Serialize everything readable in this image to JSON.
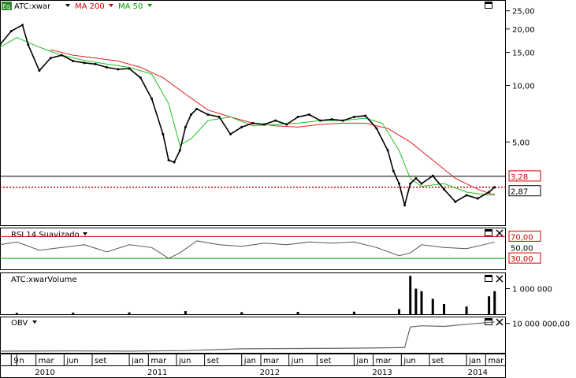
{
  "colors": {
    "ma200": "#e02020",
    "ma50": "#20c020",
    "price": "#000000",
    "rsi": "#555555",
    "level_red": "#d00000",
    "level_green": "#00a000",
    "volume": "#000000",
    "obv": "#666666",
    "grid": "#000000"
  },
  "icons": {
    "eq_badge": "eq-badge-icon",
    "maximize": "maximize-icon",
    "close": "close-icon",
    "dropdown": "dropdown-arrow-icon"
  },
  "header": {
    "badge": "Eq",
    "symbol": "ATC:xwar",
    "ma200_label": "MA 200",
    "ma50_label": "MA 50"
  },
  "price_panel": {
    "axis_ticks": [
      {
        "value": 25,
        "label": "25,00"
      },
      {
        "value": 20,
        "label": "20,00"
      },
      {
        "value": 15,
        "label": "15,00"
      },
      {
        "value": 10,
        "label": "10,00"
      },
      {
        "value": 5,
        "label": "5,00"
      }
    ],
    "level_high": {
      "value": 3.28,
      "label": "3,28"
    },
    "last_price": {
      "value": 2.87,
      "label": "2,87"
    },
    "scale": "log",
    "ylim": [
      1.8,
      28
    ]
  },
  "rsi_panel": {
    "title": "RSI 14 Suavizado",
    "ticks": [
      {
        "value": 70,
        "label": "70,00"
      },
      {
        "value": 50,
        "label": "50,00"
      },
      {
        "value": 30,
        "label": "30,00"
      }
    ],
    "ylim": [
      10,
      85
    ]
  },
  "volume_panel": {
    "title": "ATC:xwarVolume",
    "tick": {
      "value": 1000000,
      "label": "1 000 000"
    },
    "ylim": [
      0,
      1600000
    ]
  },
  "obv_panel": {
    "title": "OBV",
    "tick": {
      "value": 10000000,
      "label": "10 000 000,00"
    },
    "ylim": [
      0,
      12000000
    ]
  },
  "time_axis": {
    "month_labels": [
      {
        "date": "2009.95",
        "label": "9"
      },
      {
        "date": "2010.0",
        "label": "n"
      },
      {
        "date": "2010.17",
        "label": "mar"
      },
      {
        "date": "2010.42",
        "label": "jun"
      },
      {
        "date": "2010.67",
        "label": "set"
      },
      {
        "date": "2011.0",
        "label": "jan"
      },
      {
        "date": "2011.17",
        "label": "mar"
      },
      {
        "date": "2011.42",
        "label": "jun"
      },
      {
        "date": "2011.67",
        "label": "set"
      },
      {
        "date": "2012.0",
        "label": "jan"
      },
      {
        "date": "2012.17",
        "label": "mar"
      },
      {
        "date": "2012.42",
        "label": "jun"
      },
      {
        "date": "2012.67",
        "label": "set"
      },
      {
        "date": "2013.0",
        "label": "jan"
      },
      {
        "date": "2013.17",
        "label": "mar"
      },
      {
        "date": "2013.42",
        "label": "jun"
      },
      {
        "date": "2013.67",
        "label": "set"
      },
      {
        "date": "2014.0",
        "label": "jan"
      },
      {
        "date": "2014.17",
        "label": "mar"
      }
    ],
    "year_labels": [
      {
        "date": "2010.25",
        "label": "2010"
      },
      {
        "date": "2011.25",
        "label": "2011"
      },
      {
        "date": "2012.25",
        "label": "2012"
      },
      {
        "date": "2013.25",
        "label": "2013"
      },
      {
        "date": "2014.1",
        "label": "2014"
      }
    ]
  },
  "chart_data": [
    {
      "type": "line",
      "x_range": [
        "2009-10",
        "2014-04"
      ],
      "scale": "log",
      "ylim": [
        1.8,
        28
      ],
      "series": [
        {
          "name": "ATC:xwar",
          "x": [
            2009.85,
            2009.95,
            2010.05,
            2010.1,
            2010.2,
            2010.3,
            2010.4,
            2010.5,
            2010.6,
            2010.7,
            2010.8,
            2010.9,
            2011.0,
            2011.1,
            2011.2,
            2011.3,
            2011.35,
            2011.4,
            2011.45,
            2011.5,
            2011.55,
            2011.6,
            2011.7,
            2011.8,
            2011.9,
            2012.0,
            2012.1,
            2012.2,
            2012.3,
            2012.4,
            2012.5,
            2012.6,
            2012.7,
            2012.8,
            2012.9,
            2013.0,
            2013.1,
            2013.2,
            2013.3,
            2013.35,
            2013.4,
            2013.45,
            2013.5,
            2013.55,
            2013.6,
            2013.7,
            2013.8,
            2013.9,
            2014.0,
            2014.1,
            2014.2,
            2014.25
          ],
          "values": [
            16.5,
            19.5,
            21.0,
            16.5,
            12.0,
            14.0,
            14.5,
            13.5,
            13.2,
            13.0,
            12.5,
            12.2,
            12.3,
            11.0,
            8.5,
            5.5,
            4.0,
            3.9,
            4.5,
            6.0,
            7.0,
            7.5,
            7.0,
            6.8,
            5.5,
            6.0,
            6.3,
            6.2,
            6.5,
            6.2,
            6.8,
            7.0,
            6.5,
            6.6,
            6.5,
            6.8,
            6.9,
            5.9,
            4.5,
            3.5,
            3.0,
            2.3,
            3.0,
            3.2,
            3.0,
            3.3,
            2.8,
            2.4,
            2.6,
            2.5,
            2.7,
            2.87
          ]
        },
        {
          "name": "MA 200",
          "x": [
            2010.3,
            2010.5,
            2010.7,
            2010.9,
            2011.1,
            2011.3,
            2011.5,
            2011.7,
            2011.9,
            2012.1,
            2012.3,
            2012.5,
            2012.7,
            2012.9,
            2013.1,
            2013.3,
            2013.5,
            2013.7,
            2013.9,
            2014.1,
            2014.25
          ],
          "values": [
            15.5,
            14.5,
            14.0,
            13.5,
            12.5,
            11.0,
            9.0,
            7.4,
            6.8,
            6.3,
            6.1,
            6.0,
            6.2,
            6.3,
            6.3,
            5.9,
            5.0,
            4.0,
            3.2,
            2.8,
            2.6
          ]
        },
        {
          "name": "MA 50",
          "x": [
            2009.85,
            2010.0,
            2010.2,
            2010.4,
            2010.6,
            2010.8,
            2011.0,
            2011.2,
            2011.35,
            2011.45,
            2011.55,
            2011.7,
            2011.9,
            2012.1,
            2012.3,
            2012.5,
            2012.7,
            2012.9,
            2013.1,
            2013.25,
            2013.4,
            2013.5,
            2013.6,
            2013.8,
            2014.0,
            2014.2,
            2014.25
          ],
          "values": [
            16.0,
            18.0,
            16.0,
            14.5,
            13.6,
            13.0,
            12.5,
            11.5,
            8.0,
            4.8,
            5.2,
            6.5,
            6.8,
            6.1,
            6.2,
            6.3,
            6.5,
            6.5,
            6.7,
            6.3,
            4.5,
            3.2,
            2.9,
            3.0,
            2.7,
            2.6,
            2.65
          ]
        }
      ],
      "levels": [
        3.28,
        2.87
      ]
    },
    {
      "type": "line",
      "title": "RSI 14 Suavizado",
      "ylim": [
        10,
        85
      ],
      "series": [
        {
          "name": "RSI 14 Suavizado",
          "x": [
            2009.85,
            2010.0,
            2010.2,
            2010.4,
            2010.6,
            2010.8,
            2011.0,
            2011.2,
            2011.35,
            2011.45,
            2011.6,
            2011.8,
            2012.0,
            2012.2,
            2012.4,
            2012.6,
            2012.8,
            2013.0,
            2013.2,
            2013.4,
            2013.5,
            2013.6,
            2013.8,
            2014.0,
            2014.15,
            2014.25
          ],
          "values": [
            55,
            60,
            45,
            50,
            55,
            42,
            55,
            50,
            30,
            40,
            62,
            55,
            52,
            58,
            55,
            60,
            58,
            60,
            50,
            35,
            40,
            55,
            50,
            48,
            55,
            60
          ]
        }
      ],
      "levels": [
        70,
        50,
        30
      ]
    },
    {
      "type": "bar",
      "title": "ATC:xwarVolume",
      "ylim": [
        0,
        1600000
      ],
      "x": [
        2010.0,
        2010.5,
        2011.0,
        2011.5,
        2012.0,
        2012.5,
        2013.0,
        2013.4,
        2013.5,
        2013.55,
        2013.6,
        2013.7,
        2013.8,
        2014.0,
        2014.2,
        2014.25
      ],
      "values": [
        50000,
        60000,
        70000,
        120000,
        80000,
        90000,
        100000,
        200000,
        1500000,
        1000000,
        900000,
        600000,
        400000,
        300000,
        700000,
        900000
      ]
    },
    {
      "type": "line",
      "title": "OBV",
      "ylim": [
        0,
        12000000
      ],
      "series": [
        {
          "name": "OBV",
          "x": [
            2009.85,
            2010.5,
            2011.0,
            2011.5,
            2012.0,
            2012.5,
            2013.0,
            2013.45,
            2013.5,
            2013.6,
            2013.8,
            2014.0,
            2014.25
          ],
          "values": [
            800000,
            900000,
            800000,
            1000000,
            1600000,
            1700000,
            1800000,
            2000000,
            8800000,
            9200000,
            9000000,
            9700000,
            10500000
          ]
        }
      ]
    }
  ]
}
